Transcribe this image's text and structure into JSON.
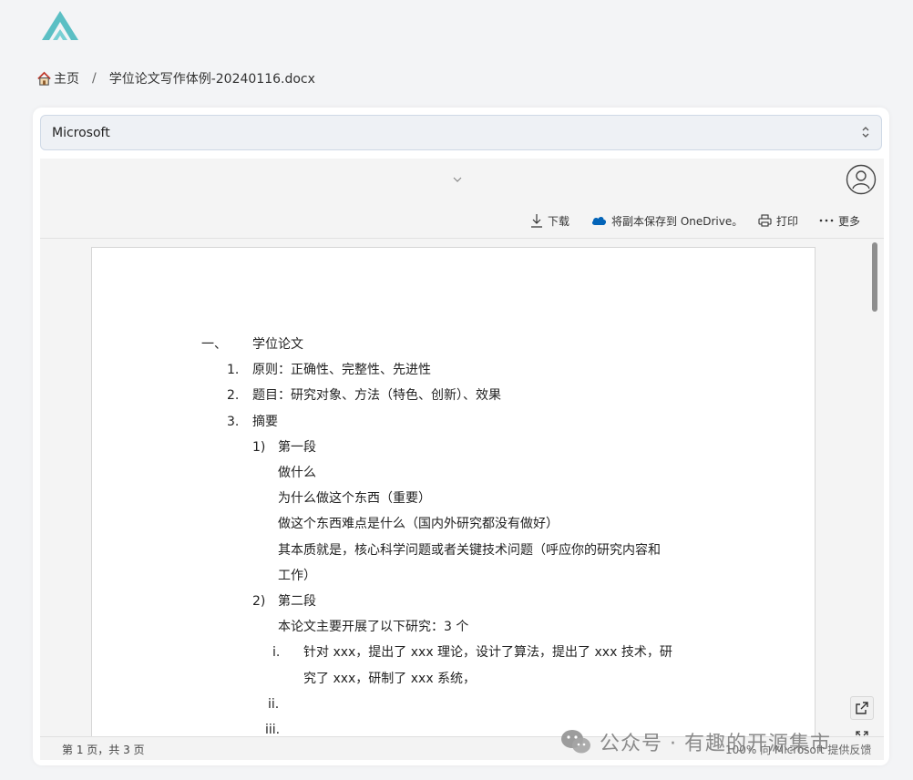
{
  "header": {
    "logo_icon": "logo-icon"
  },
  "breadcrumb": {
    "home": "主页",
    "separator": "/",
    "file": "学位论文写作体例-20240116.docx"
  },
  "selector": {
    "value": "Microsoft"
  },
  "toolbar": {
    "download": "下载",
    "save_onedrive": "将副本保存到 OneDrive。",
    "print": "打印",
    "more": "更多"
  },
  "document": {
    "lines": [
      {
        "marker": "一、",
        "text": "学位论文"
      },
      {
        "marker": "1.",
        "text": "原则：正确性、完整性、先进性"
      },
      {
        "marker": "2.",
        "text": "题目：研究对象、方法（特色、创新）、效果"
      },
      {
        "marker": "3.",
        "text": "摘要"
      },
      {
        "marker": "1)",
        "text": "第一段"
      },
      {
        "marker": "",
        "text": "做什么"
      },
      {
        "marker": "",
        "text": "为什么做这个东西（重要）"
      },
      {
        "marker": "",
        "text": "做这个东西难点是什么（国内外研究都没有做好）"
      },
      {
        "marker": "",
        "text": "其本质就是，核心科学问题或者关键技术问题（呼应你的研究内容和"
      },
      {
        "marker": "",
        "text": "工作）"
      },
      {
        "marker": "2)",
        "text": "第二段"
      },
      {
        "marker": "",
        "text": "本论文主要开展了以下研究：3 个"
      },
      {
        "marker": "i.",
        "text": "针对 xxx，提出了 xxx 理论，设计了算法，提出了 xxx 技术，研"
      },
      {
        "marker": "",
        "text": "究了 xxx，研制了 xxx 系统，"
      },
      {
        "marker": "ii.",
        "text": ""
      },
      {
        "marker": "iii.",
        "text": ""
      }
    ]
  },
  "status": {
    "page_info": "第 1 页，共 3 页",
    "zoom_text": "100%  向 Microsoft 提供反馈"
  },
  "watermark": {
    "text": "公众号 · 有趣的开源集市"
  },
  "colors": {
    "accent": "#0078d4",
    "logo": "#5bbfc4",
    "onedrive": "#0364b8"
  }
}
